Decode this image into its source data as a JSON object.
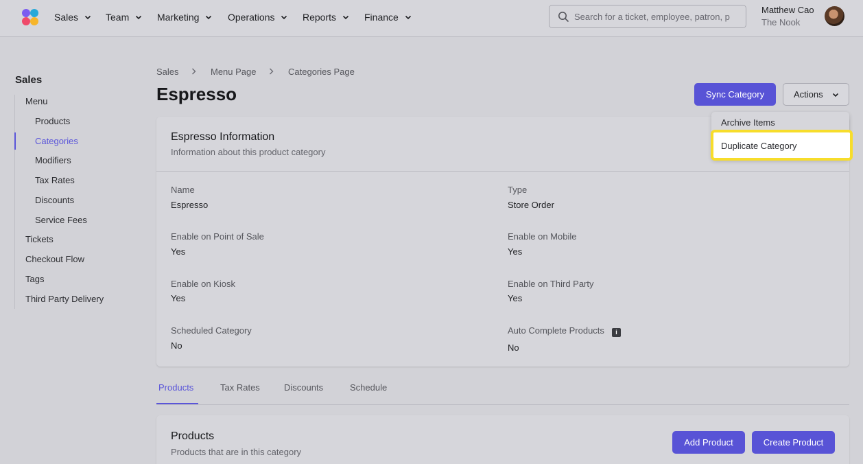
{
  "nav": {
    "items": [
      "Sales",
      "Team",
      "Marketing",
      "Operations",
      "Reports",
      "Finance"
    ],
    "search_placeholder": "Search for a ticket, employee, patron, p",
    "user_name": "Matthew Cao",
    "user_org": "The Nook"
  },
  "sidebar": {
    "title": "Sales",
    "items": [
      {
        "label": "Menu",
        "level": 1
      },
      {
        "label": "Products",
        "level": 2
      },
      {
        "label": "Categories",
        "level": 2,
        "active": true
      },
      {
        "label": "Modifiers",
        "level": 2
      },
      {
        "label": "Tax Rates",
        "level": 2
      },
      {
        "label": "Discounts",
        "level": 2
      },
      {
        "label": "Service Fees",
        "level": 2
      },
      {
        "label": "Tickets",
        "level": 1
      },
      {
        "label": "Checkout Flow",
        "level": 1
      },
      {
        "label": "Tags",
        "level": 1
      },
      {
        "label": "Third Party Delivery",
        "level": 1
      }
    ]
  },
  "breadcrumb": [
    "Sales",
    "Menu Page",
    "Categories Page"
  ],
  "page_title": "Espresso",
  "header_buttons": {
    "sync": "Sync Category",
    "actions": "Actions"
  },
  "actions_menu": {
    "items": [
      "Archive Items",
      "Duplicate Category"
    ],
    "highlighted": "Duplicate Category"
  },
  "info_card": {
    "title": "Espresso Information",
    "subtitle": "Information about this product category",
    "fields": [
      {
        "label": "Name",
        "value": "Espresso"
      },
      {
        "label": "Type",
        "value": "Store Order"
      },
      {
        "label": "Enable on Point of Sale",
        "value": "Yes"
      },
      {
        "label": "Enable on Mobile",
        "value": "Yes"
      },
      {
        "label": "Enable on Kiosk",
        "value": "Yes"
      },
      {
        "label": "Enable on Third Party",
        "value": "Yes"
      },
      {
        "label": "Scheduled Category",
        "value": "No"
      },
      {
        "label": "Auto Complete Products",
        "value": "No"
      }
    ]
  },
  "tabs": [
    "Products",
    "Tax Rates",
    "Discounts",
    "Schedule"
  ],
  "active_tab": "Products",
  "products_card": {
    "title": "Products",
    "subtitle": "Products that are in this category",
    "add_button": "Add Product",
    "create_button": "Create Product"
  },
  "colors": {
    "accent": "#5853d6",
    "highlight": "#f7dd2b",
    "background": "#d2d2d7"
  }
}
